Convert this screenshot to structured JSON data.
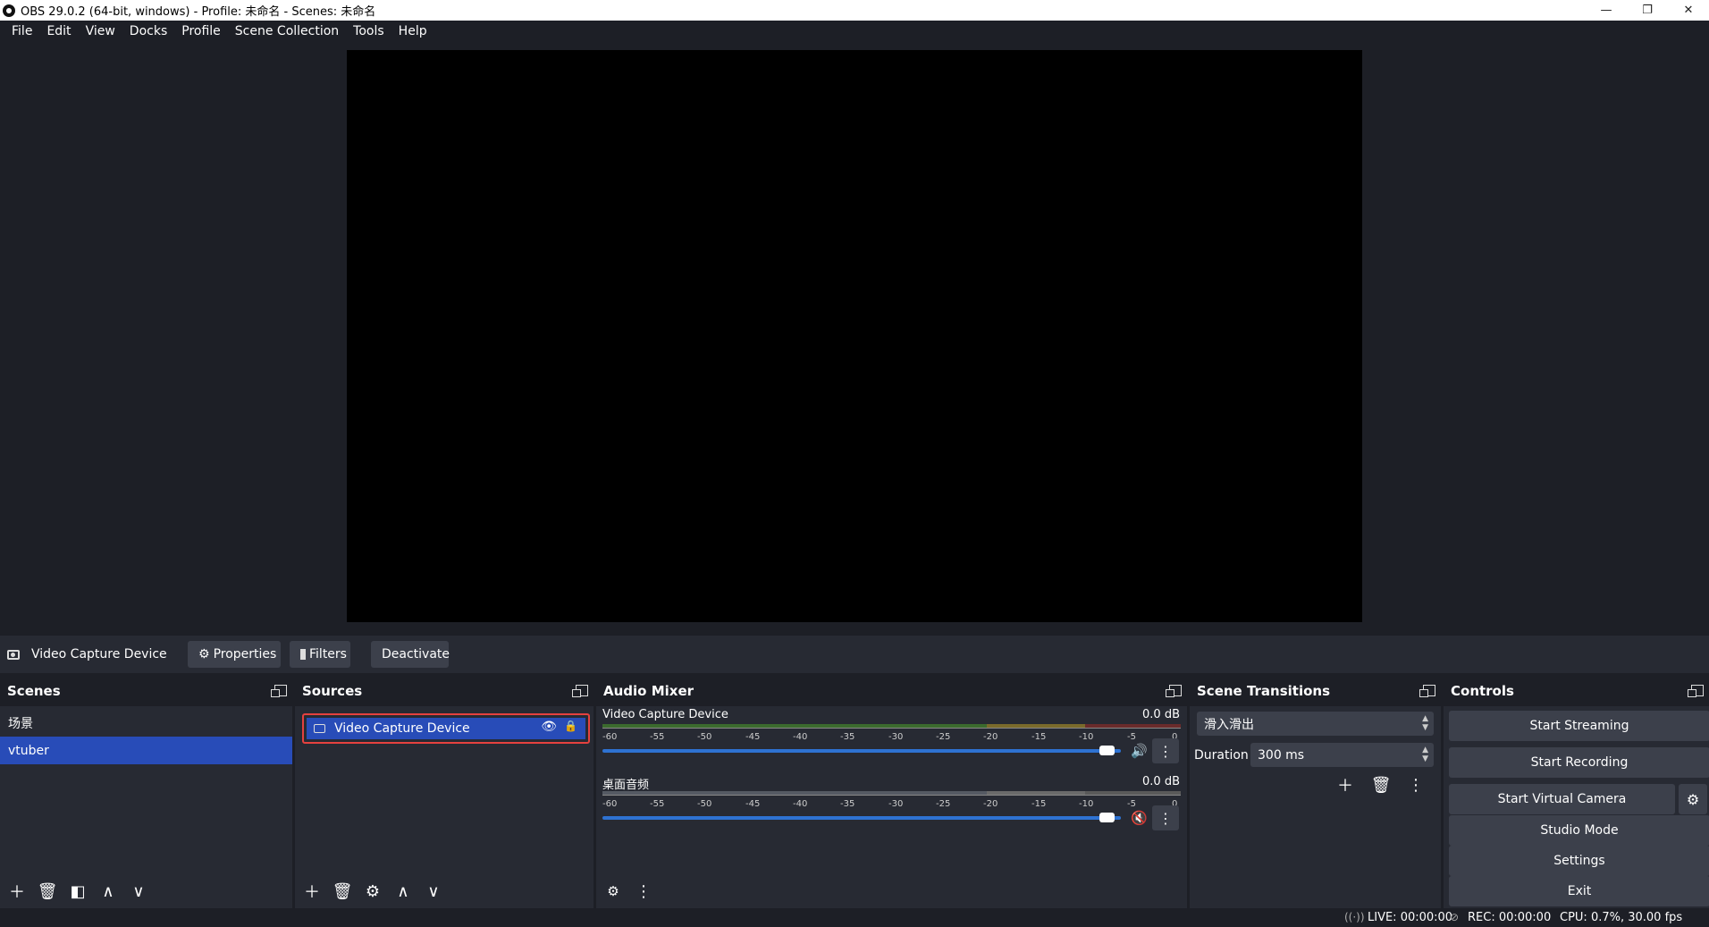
{
  "window": {
    "title": "OBS 29.0.2 (64-bit, windows) - Profile: 未命名 - Scenes: 未命名",
    "minimize": "—",
    "restore": "❐",
    "close": "✕"
  },
  "menu": [
    "File",
    "Edit",
    "View",
    "Docks",
    "Profile",
    "Scene Collection",
    "Tools",
    "Help"
  ],
  "source_toolbar": {
    "source_name": "Video Capture Device",
    "properties": "Properties",
    "filters": "Filters",
    "deactivate": "Deactivate"
  },
  "scenes": {
    "title": "Scenes",
    "items": [
      "场景",
      "vtuber"
    ],
    "selected": "vtuber"
  },
  "sources": {
    "title": "Sources",
    "items": [
      "Video Capture Device"
    ]
  },
  "audio_mixer": {
    "title": "Audio Mixer",
    "channels": [
      {
        "name": "Video Capture Device",
        "db": "0.0 dB",
        "muted": false,
        "volume": 1.0
      },
      {
        "name": "桌面音频",
        "db": "0.0 dB",
        "muted": true,
        "volume": 1.0
      }
    ],
    "tick_labels": [
      "-60",
      "-55",
      "-50",
      "-45",
      "-40",
      "-35",
      "-30",
      "-25",
      "-20",
      "-15",
      "-10",
      "-5",
      "0"
    ]
  },
  "transitions": {
    "title": "Scene Transitions",
    "selected": "滑入滑出",
    "duration_label": "Duration",
    "duration_value": "300 ms"
  },
  "controls": {
    "title": "Controls",
    "start_streaming": "Start Streaming",
    "start_recording": "Start Recording",
    "start_virtual_camera": "Start Virtual Camera",
    "studio_mode": "Studio Mode",
    "settings": "Settings",
    "exit": "Exit"
  },
  "status": {
    "live": "LIVE: 00:00:00",
    "rec": "REC: 00:00:00",
    "cpu": "CPU: 0.7%, 30.00 fps"
  },
  "colors": {
    "background": "#1d1f26",
    "panel": "#272a33",
    "button": "#3c404b",
    "selection": "#284cb8",
    "highlight_border": "#e5413f",
    "volume_bar": "#2e72d2",
    "muted": "#d23a3a"
  }
}
